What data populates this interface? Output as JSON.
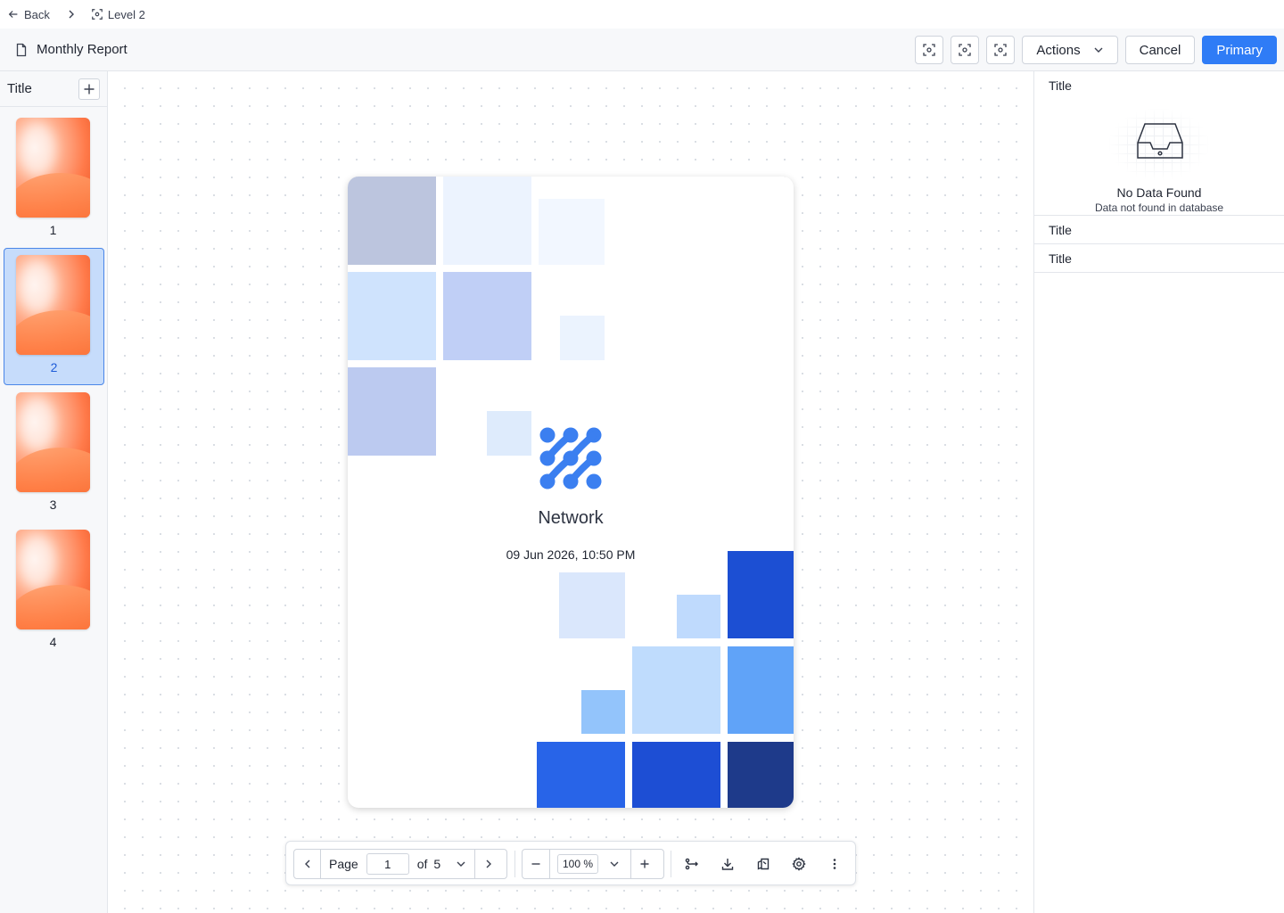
{
  "breadcrumb": {
    "back_label": "Back",
    "current_label": "Level 2"
  },
  "header": {
    "title": "Monthly Report",
    "actions_label": "Actions",
    "cancel_label": "Cancel",
    "primary_label": "Primary"
  },
  "sidebar": {
    "title": "Title",
    "pages": [
      {
        "number": "1"
      },
      {
        "number": "2",
        "selected": true
      },
      {
        "number": "3"
      },
      {
        "number": "4"
      }
    ]
  },
  "document": {
    "title": "Network",
    "date": "09 Jun 2026, 10:50 PM"
  },
  "toolbar": {
    "page_label": "Page",
    "page_value": "1",
    "of_label": "of",
    "total_pages": "5",
    "zoom_value": "100 %"
  },
  "panel": {
    "section1_title": "Title",
    "empty_title": "No Data Found",
    "empty_subtitle": "Data not found in database",
    "section2_title": "Title",
    "section3_title": "Title"
  },
  "colors": {
    "primary": "#2f7cf6",
    "selection": "#c6dcfb",
    "logo": "#3b7ff0"
  }
}
